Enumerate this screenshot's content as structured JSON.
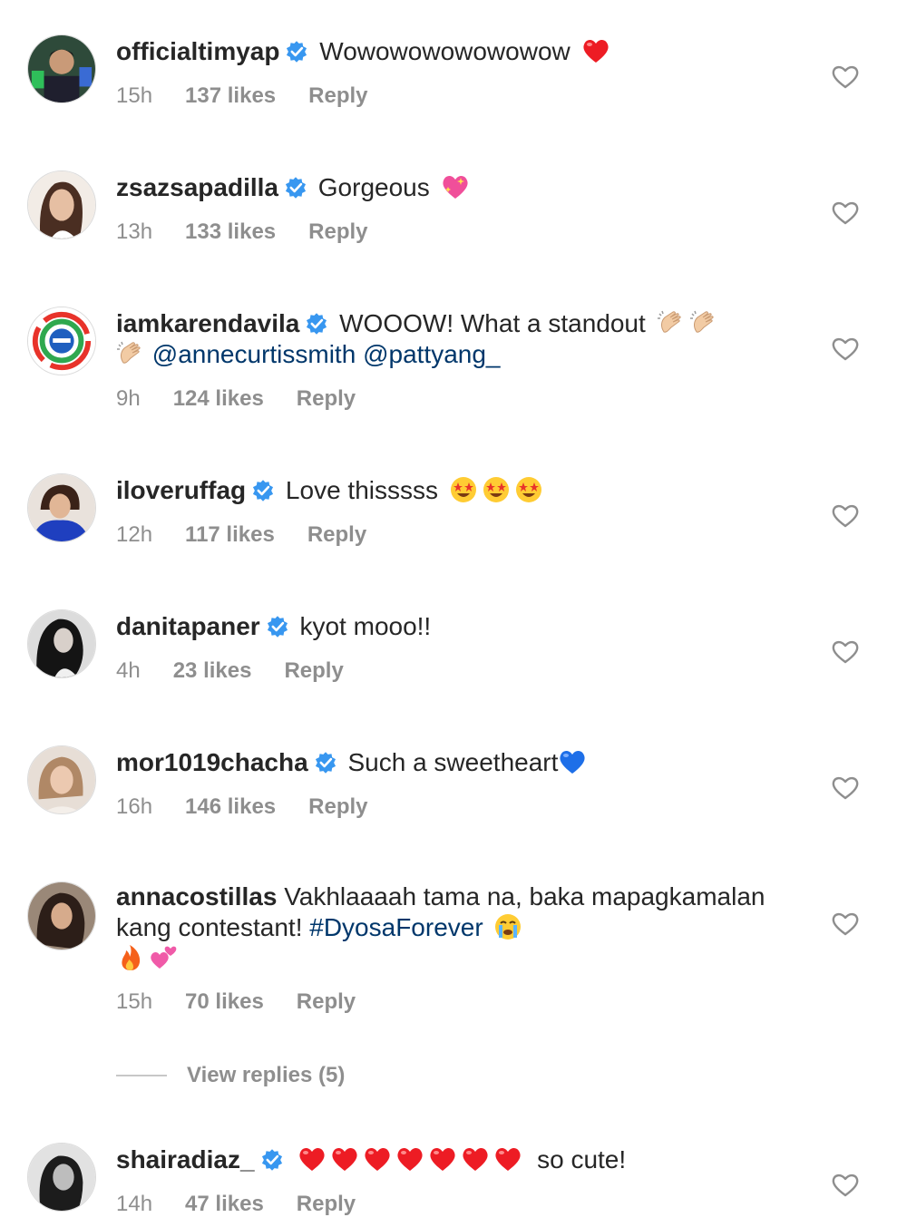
{
  "comments": [
    {
      "username": "officialtimyap",
      "text": "Wowowowowowowow",
      "time": "15h",
      "likes": "137 likes",
      "reply": "Reply",
      "verified": true,
      "avatar_color": "#2e4a3a",
      "emojis": [
        "red-heart"
      ]
    },
    {
      "username": "zsazsapadilla",
      "text": "Gorgeous",
      "time": "13h",
      "likes": "133 likes",
      "reply": "Reply",
      "verified": true,
      "avatar_color": "#d9b9a6",
      "emojis": [
        "sparkling-heart"
      ]
    },
    {
      "username": "iamkarendavila",
      "text": "WOOOW! What a standout",
      "mentions": "@annecurtissmith @pattyang_",
      "time": "9h",
      "likes": "124 likes",
      "reply": "Reply",
      "verified": true,
      "avatar_color": "#ffffff",
      "emojis": [
        "clapping-hands",
        "clapping-hands",
        "clapping-hands"
      ]
    },
    {
      "username": "iloveruffag",
      "text": "Love thisssss",
      "time": "12h",
      "likes": "117 likes",
      "reply": "Reply",
      "verified": true,
      "avatar_color": "#1f3fbf",
      "emojis": [
        "star-struck",
        "star-struck",
        "star-struck"
      ]
    },
    {
      "username": "danitapaner",
      "text": "kyot mooo!!",
      "time": "4h",
      "likes": "23 likes",
      "reply": "Reply",
      "verified": true,
      "avatar_color": "#3a3a3a",
      "emojis": []
    },
    {
      "username": "mor1019chacha",
      "text": "Such a sweetheart",
      "time": "16h",
      "likes": "146 likes",
      "reply": "Reply",
      "verified": true,
      "avatar_color": "#cdb7a6",
      "emojis": [
        "blue-heart"
      ]
    },
    {
      "username": "annacostillas",
      "text": "Vakhlaaaah tama na, baka mapagkamalan kang contestant!",
      "hashtag": "#DyosaForever",
      "time": "15h",
      "likes": "70 likes",
      "reply": "Reply",
      "verified": false,
      "avatar_color": "#4a3a33",
      "emojis": [
        "crying-face",
        "fire",
        "two-hearts"
      ]
    },
    {
      "username": "shairadiaz_",
      "text": "so cute!",
      "time": "14h",
      "likes": "47 likes",
      "reply": "Reply",
      "verified": true,
      "avatar_color": "#555555",
      "emojis": [
        "red-heart",
        "red-heart",
        "red-heart",
        "red-heart",
        "red-heart",
        "red-heart",
        "red-heart"
      ]
    }
  ],
  "view_replies": "View replies (5)",
  "colors": {
    "verified": "#3897f0",
    "mention": "#00376b",
    "meta": "#8e8e8e",
    "heart_red": "#ed1c24",
    "heart_blue": "#1e6fe8"
  }
}
